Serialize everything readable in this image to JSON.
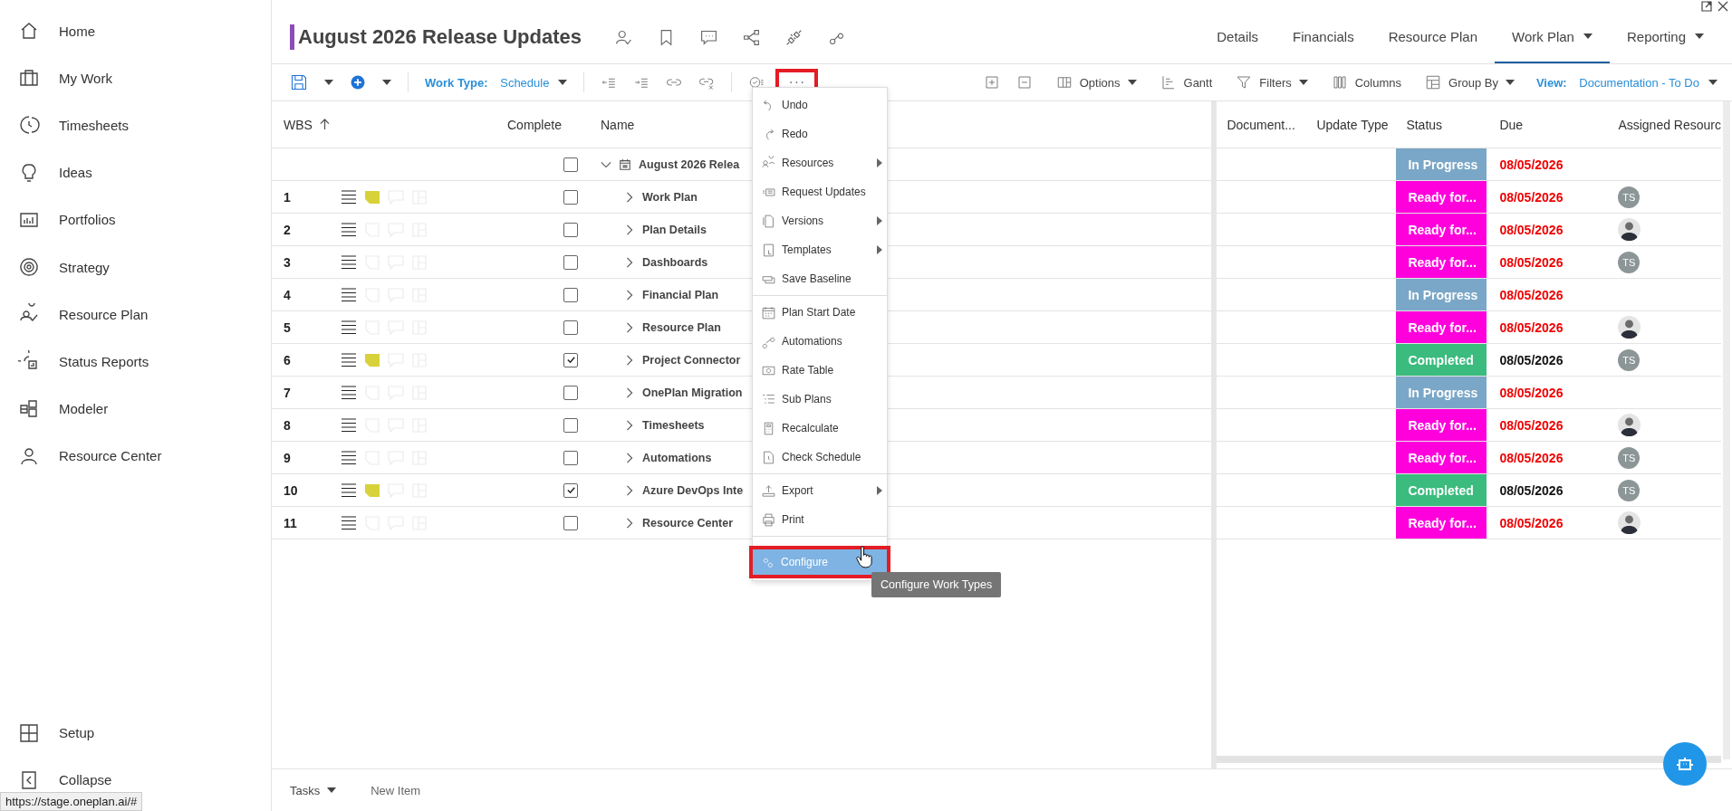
{
  "sidebar": {
    "items": [
      {
        "label": "Home"
      },
      {
        "label": "My Work"
      },
      {
        "label": "Timesheets"
      },
      {
        "label": "Ideas"
      },
      {
        "label": "Portfolios"
      },
      {
        "label": "Strategy"
      },
      {
        "label": "Resource Plan"
      },
      {
        "label": "Status Reports"
      },
      {
        "label": "Modeler"
      },
      {
        "label": "Resource Center"
      }
    ],
    "footer": [
      {
        "label": "Setup"
      },
      {
        "label": "Collapse"
      }
    ]
  },
  "header": {
    "title": "August 2026 Release Updates",
    "tabs": [
      {
        "label": "Details",
        "selected": false,
        "has_menu": false
      },
      {
        "label": "Financials",
        "selected": false,
        "has_menu": false
      },
      {
        "label": "Resource Plan",
        "selected": false,
        "has_menu": false
      },
      {
        "label": "Work Plan",
        "selected": true,
        "has_menu": true
      },
      {
        "label": "Reporting",
        "selected": false,
        "has_menu": true
      }
    ]
  },
  "toolbar": {
    "work_type_label": "Work Type:",
    "work_type_value": "Schedule",
    "more": {
      "label": "···",
      "annotated": true
    },
    "right": [
      {
        "label": "Options",
        "has_menu": true
      },
      {
        "label": "Gantt",
        "has_menu": false
      },
      {
        "label": "Filters",
        "has_menu": true
      },
      {
        "label": "Columns",
        "has_menu": false
      },
      {
        "label": "Group By",
        "has_menu": true
      }
    ],
    "view_label": "View:",
    "view_value": "Documentation - To Do"
  },
  "grid": {
    "columns": [
      "WBS",
      "Complete",
      "Name"
    ],
    "parent": {
      "name": "August 2026 Relea",
      "complete": false,
      "expanded": true
    },
    "rows": [
      {
        "wbs": "1",
        "has_note": true,
        "complete": false,
        "name": "Work Plan"
      },
      {
        "wbs": "2",
        "has_note": false,
        "complete": false,
        "name": "Plan Details"
      },
      {
        "wbs": "3",
        "has_note": false,
        "complete": false,
        "name": "Dashboards"
      },
      {
        "wbs": "4",
        "has_note": false,
        "complete": false,
        "name": "Financial Plan"
      },
      {
        "wbs": "5",
        "has_note": false,
        "complete": false,
        "name": "Resource Plan"
      },
      {
        "wbs": "6",
        "has_note": true,
        "complete": true,
        "name": "Project Connector"
      },
      {
        "wbs": "7",
        "has_note": false,
        "complete": false,
        "name": "OnePlan Migration"
      },
      {
        "wbs": "8",
        "has_note": false,
        "complete": false,
        "name": "Timesheets"
      },
      {
        "wbs": "9",
        "has_note": false,
        "complete": false,
        "name": "Automations"
      },
      {
        "wbs": "10",
        "has_note": true,
        "complete": true,
        "name": "Azure DevOps Inte"
      },
      {
        "wbs": "11",
        "has_note": false,
        "complete": false,
        "name": "Resource Center"
      }
    ]
  },
  "detail": {
    "columns": [
      "Document...",
      "Update Type",
      "Status",
      "Due",
      "Assigned Resourc"
    ],
    "rows": [
      {
        "status": "In Progress",
        "color": "#7aa7c7",
        "due": "08/05/2026",
        "overdue": true
      },
      {
        "status": "Ready for...",
        "color": "#ff00dd",
        "due": "08/05/2026",
        "overdue": true,
        "assignee": {
          "kind": "initials",
          "initials": "TS"
        }
      },
      {
        "status": "Ready for...",
        "color": "#ff00dd",
        "due": "08/05/2026",
        "overdue": true,
        "assignee": {
          "kind": "photo"
        }
      },
      {
        "status": "Ready for...",
        "color": "#ff00dd",
        "due": "08/05/2026",
        "overdue": true,
        "assignee": {
          "kind": "initials",
          "initials": "TS"
        }
      },
      {
        "status": "In Progress",
        "color": "#7aa7c7",
        "due": "08/05/2026",
        "overdue": true
      },
      {
        "status": "Ready for...",
        "color": "#ff00dd",
        "due": "08/05/2026",
        "overdue": true,
        "assignee": {
          "kind": "photo"
        }
      },
      {
        "status": "Completed",
        "color": "#3bbb7e",
        "due": "08/05/2026",
        "overdue": false,
        "assignee": {
          "kind": "initials",
          "initials": "TS"
        }
      },
      {
        "status": "In Progress",
        "color": "#7aa7c7",
        "due": "08/05/2026",
        "overdue": true
      },
      {
        "status": "Ready for...",
        "color": "#ff00dd",
        "due": "08/05/2026",
        "overdue": true,
        "assignee": {
          "kind": "photo"
        }
      },
      {
        "status": "Ready for...",
        "color": "#ff00dd",
        "due": "08/05/2026",
        "overdue": true,
        "assignee": {
          "kind": "initials",
          "initials": "TS"
        }
      },
      {
        "status": "Completed",
        "color": "#3bbb7e",
        "due": "08/05/2026",
        "overdue": false,
        "assignee": {
          "kind": "initials",
          "initials": "TS"
        }
      },
      {
        "status": "Ready for...",
        "color": "#ff00dd",
        "due": "08/05/2026",
        "overdue": true,
        "assignee": {
          "kind": "photo"
        }
      }
    ]
  },
  "menu": {
    "groups": [
      [
        {
          "label": "Undo",
          "has_submenu": false,
          "selected": false
        },
        {
          "label": "Redo",
          "has_submenu": false,
          "selected": false
        },
        {
          "label": "Resources",
          "has_submenu": true,
          "selected": false
        },
        {
          "label": "Request Updates",
          "has_submenu": false,
          "selected": false
        },
        {
          "label": "Versions",
          "has_submenu": true,
          "selected": false
        },
        {
          "label": "Templates",
          "has_submenu": true,
          "selected": false
        },
        {
          "label": "Save Baseline",
          "has_submenu": false,
          "selected": false
        }
      ],
      [
        {
          "label": "Plan Start Date",
          "has_submenu": false,
          "selected": false
        },
        {
          "label": "Automations",
          "has_submenu": false,
          "selected": false
        },
        {
          "label": "Rate Table",
          "has_submenu": false,
          "selected": false
        },
        {
          "label": "Sub Plans",
          "has_submenu": false,
          "selected": false
        },
        {
          "label": "Recalculate",
          "has_submenu": false,
          "selected": false
        },
        {
          "label": "Check Schedule",
          "has_submenu": false,
          "selected": false
        }
      ],
      [
        {
          "label": "Export",
          "has_submenu": true,
          "selected": false
        },
        {
          "label": "Print",
          "has_submenu": false,
          "selected": false
        }
      ],
      [
        {
          "label": "Configure",
          "has_submenu": false,
          "selected": true,
          "annotated": true
        }
      ]
    ],
    "tooltip": "Configure Work Types"
  },
  "bottom": {
    "tab": "Tasks",
    "new_item": "New Item"
  },
  "status_url": "https://stage.oneplan.ai/#"
}
